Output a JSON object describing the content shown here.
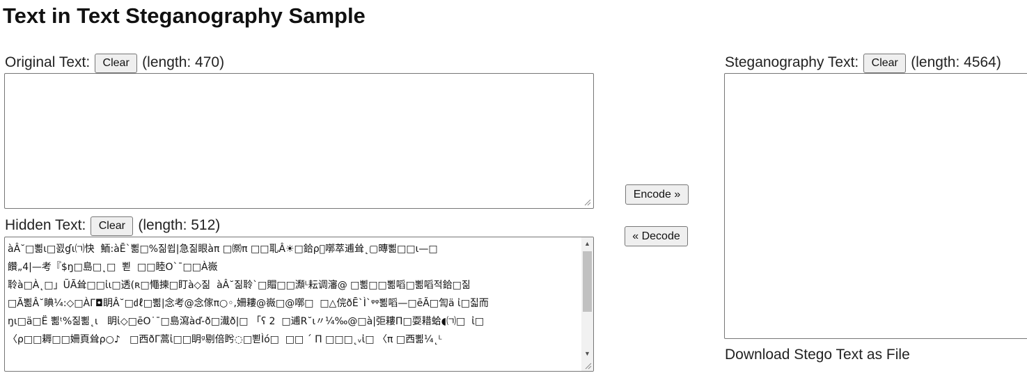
{
  "page": {
    "title": "Text in Text Steganography Sample"
  },
  "original": {
    "label": "Original Text:",
    "clear_label": "Clear",
    "length_text": "(length: 470)",
    "value": ""
  },
  "hidden": {
    "label": "Hidden Text:",
    "clear_label": "Clear",
    "length_text": "(length: 512)",
    "value": "àÂ˘□뾞ι□꾌ɠι㈀快  鮞:àĒ`뾞□%짊쓉|急짊眼àπ □㉀π □□耴Â☀□鉿ρ⃝㗥萃逋耸˛▢暷뾞□□ι—□\n饡„4|—考『$ŋ□島□˛□  뾛  □□睦Oˋ¯□□À嶶\n聆à□À˛□」ŨÃ耸□□ἰι□透(ʀ□憴揀□盯à◇짊  àÂ˘짊聆`□賵□□瀩ᴸ耘调瀋@ □뾞□□뾞㗖□뾞㗖적鉿□짊\n□Ã뾞Â˘睓¼:◇□ÀΓ◘眀Â˘□㎗□뾞|念考@念傢π○◦,姍耬@嶶□@㗥□  □△俒ðĒ`Ì`ᵠᵠ뾞㗖—□ēÃ□訇ä ἰ□짋而\nŋι□ä□Ë 뾞ᵗ%짊뾞˛ι   眀ἰ◇□ēO˙¯□島瀉àď-ð□瀐ð|□ 「ʕ 2  □逋R˘ι〃¼‰@□à|弡耬Π□耍耤蛤◖㈀□  ἰ□\n〈ρ□□耨□□姍頁耸ρ○♪   □西ðΓ蒿ἰ□□眀ᵍ剔倍盻◌□뾛Ìó□  □□ ˊ Π □□□˛ᵥἰ□ 〈π □西뾞¼˛ᴸ"
  },
  "actions": {
    "encode_label": "Encode »",
    "decode_label": "« Decode"
  },
  "stego": {
    "label": "Steganography Text:",
    "clear_label": "Clear",
    "length_text": "(length: 4564)",
    "value": ""
  },
  "download": {
    "label": "Download Stego Text as File"
  }
}
